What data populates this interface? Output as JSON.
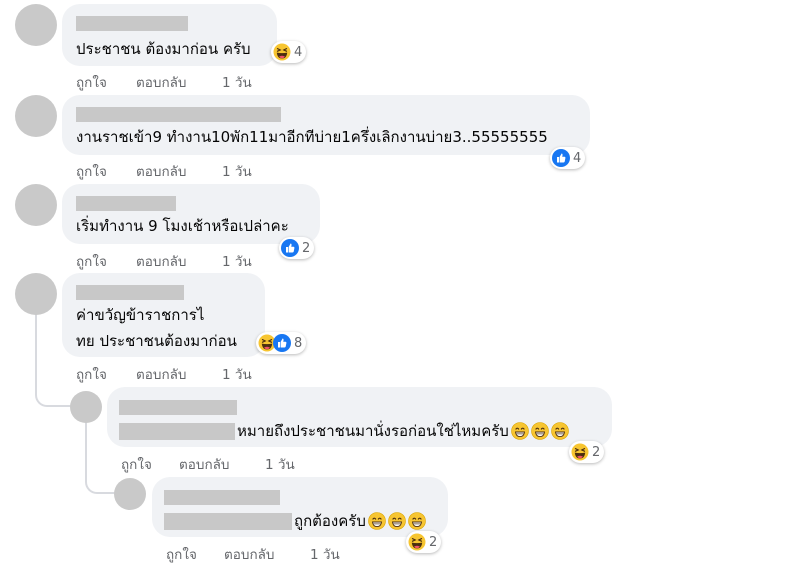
{
  "comments": [
    {
      "text": "ประชาชน ต้องมาก่อน ครับ",
      "reactions": [
        "haha"
      ],
      "reaction_count": "4",
      "like": "ถูกใจ",
      "reply": "ตอบกลับ",
      "time": "1 วัน"
    },
    {
      "text": "งานราชเข้า9 ทำงาน10พัก11มาอีกทีบ่าย1ครึ่งเลิกงานบ่าย3..55555555",
      "reactions": [
        "like"
      ],
      "reaction_count": "4",
      "like": "ถูกใจ",
      "reply": "ตอบกลับ",
      "time": "1 วัน"
    },
    {
      "text": "เริ่มทำงาน 9 โมงเช้าหรือเปล่าคะ",
      "reactions": [
        "like"
      ],
      "reaction_count": "2",
      "like": "ถูกใจ",
      "reply": "ตอบกลับ",
      "time": "1 วัน"
    },
    {
      "text_line1": "ค่าขวัญข้าราชการไ",
      "text_line2": "ทย ประชาชนต้องมาก่อน",
      "reactions": [
        "haha",
        "like"
      ],
      "reaction_count": "8",
      "like": "ถูกใจ",
      "reply": "ตอบกลับ",
      "time": "1 วัน"
    }
  ],
  "replies": [
    {
      "text": "หมายถึงประชาชนมานั่งรอก่อนใช่ไหมครับ",
      "inline_emoji": [
        "grin",
        "grin",
        "grin"
      ],
      "reactions": [
        "haha"
      ],
      "reaction_count": "2",
      "like": "ถูกใจ",
      "reply": "ตอบกลับ",
      "time": "1 วัน"
    },
    {
      "text": "ถูกต้องครับ",
      "inline_emoji": [
        "grin",
        "grin",
        "grin"
      ],
      "reactions": [
        "haha"
      ],
      "reaction_count": "2",
      "like": "ถูกใจ",
      "reply": "ตอบกลับ",
      "time": "1 วัน"
    }
  ],
  "colors": {
    "bubble": "#f0f2f5",
    "like_blue": "#1877f2",
    "emoji_yellow": "#f7c531",
    "meta_gray": "#65676b",
    "redacted": "#c8c8c8"
  }
}
